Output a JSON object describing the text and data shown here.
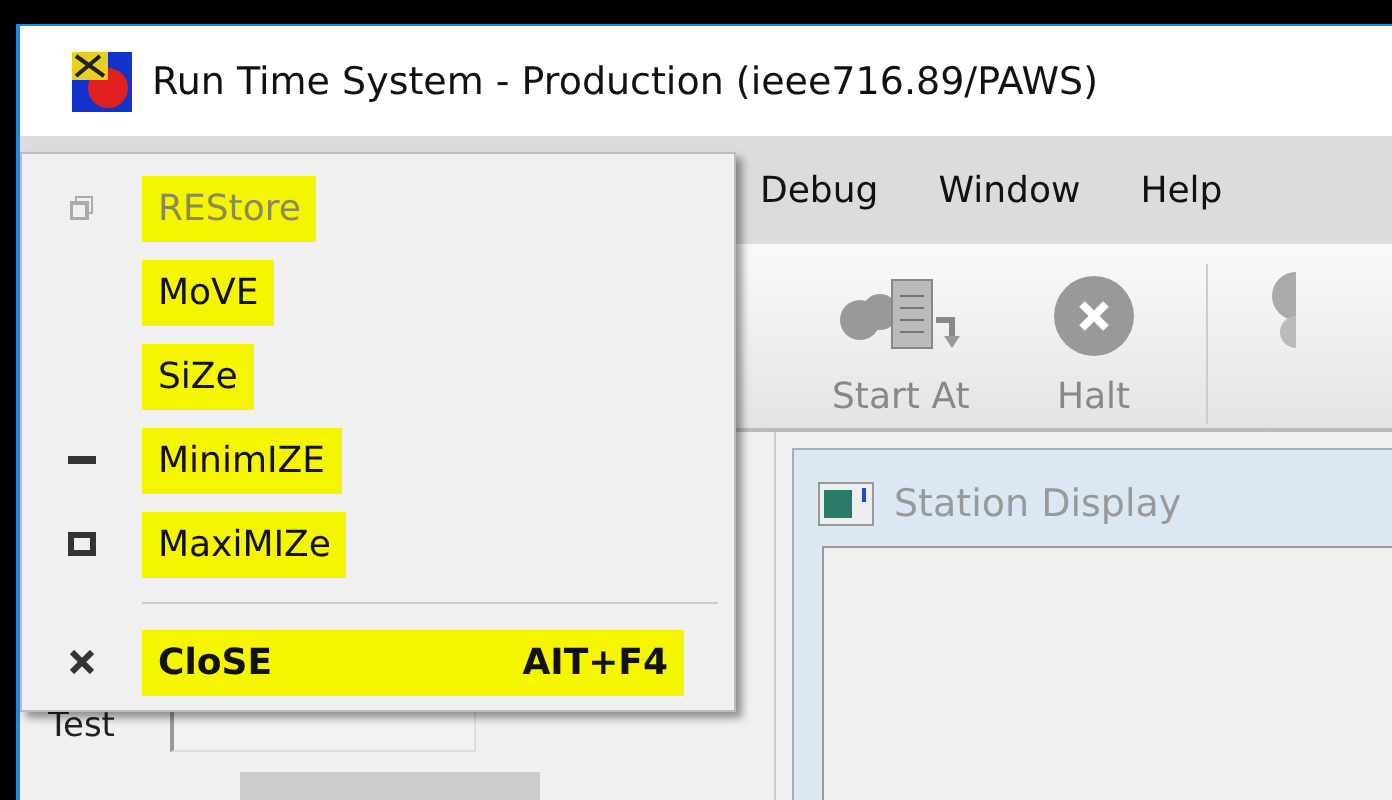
{
  "window": {
    "title": "Run Time System - Production (ieee716.89/PAWS)"
  },
  "menu_bar": [
    "Debug",
    "Window",
    "Help"
  ],
  "toolbar": [
    {
      "label": "Start At",
      "kind": "start"
    },
    {
      "label": "Halt",
      "kind": "halt"
    }
  ],
  "left_panel": {
    "label": "Test"
  },
  "child_window": {
    "title": "Station Display"
  },
  "system_menu": [
    {
      "label": "REStore",
      "kind": "restore",
      "disabled": true,
      "highlighted": true,
      "bold": false
    },
    {
      "label": "MoVE",
      "kind": "none",
      "disabled": false,
      "highlighted": true,
      "bold": false
    },
    {
      "label": "SiZe",
      "kind": "none",
      "disabled": false,
      "highlighted": true,
      "bold": false
    },
    {
      "label": "MinimIZE",
      "kind": "minimize",
      "disabled": false,
      "highlighted": true,
      "bold": false
    },
    {
      "label": "MaxiMIZe",
      "kind": "maximize",
      "disabled": false,
      "highlighted": true,
      "bold": false
    },
    {
      "kind": "separator"
    },
    {
      "label": "CloSE",
      "shortcut": "AIT+F4",
      "kind": "close",
      "disabled": false,
      "highlighted": true,
      "bold": true
    }
  ]
}
